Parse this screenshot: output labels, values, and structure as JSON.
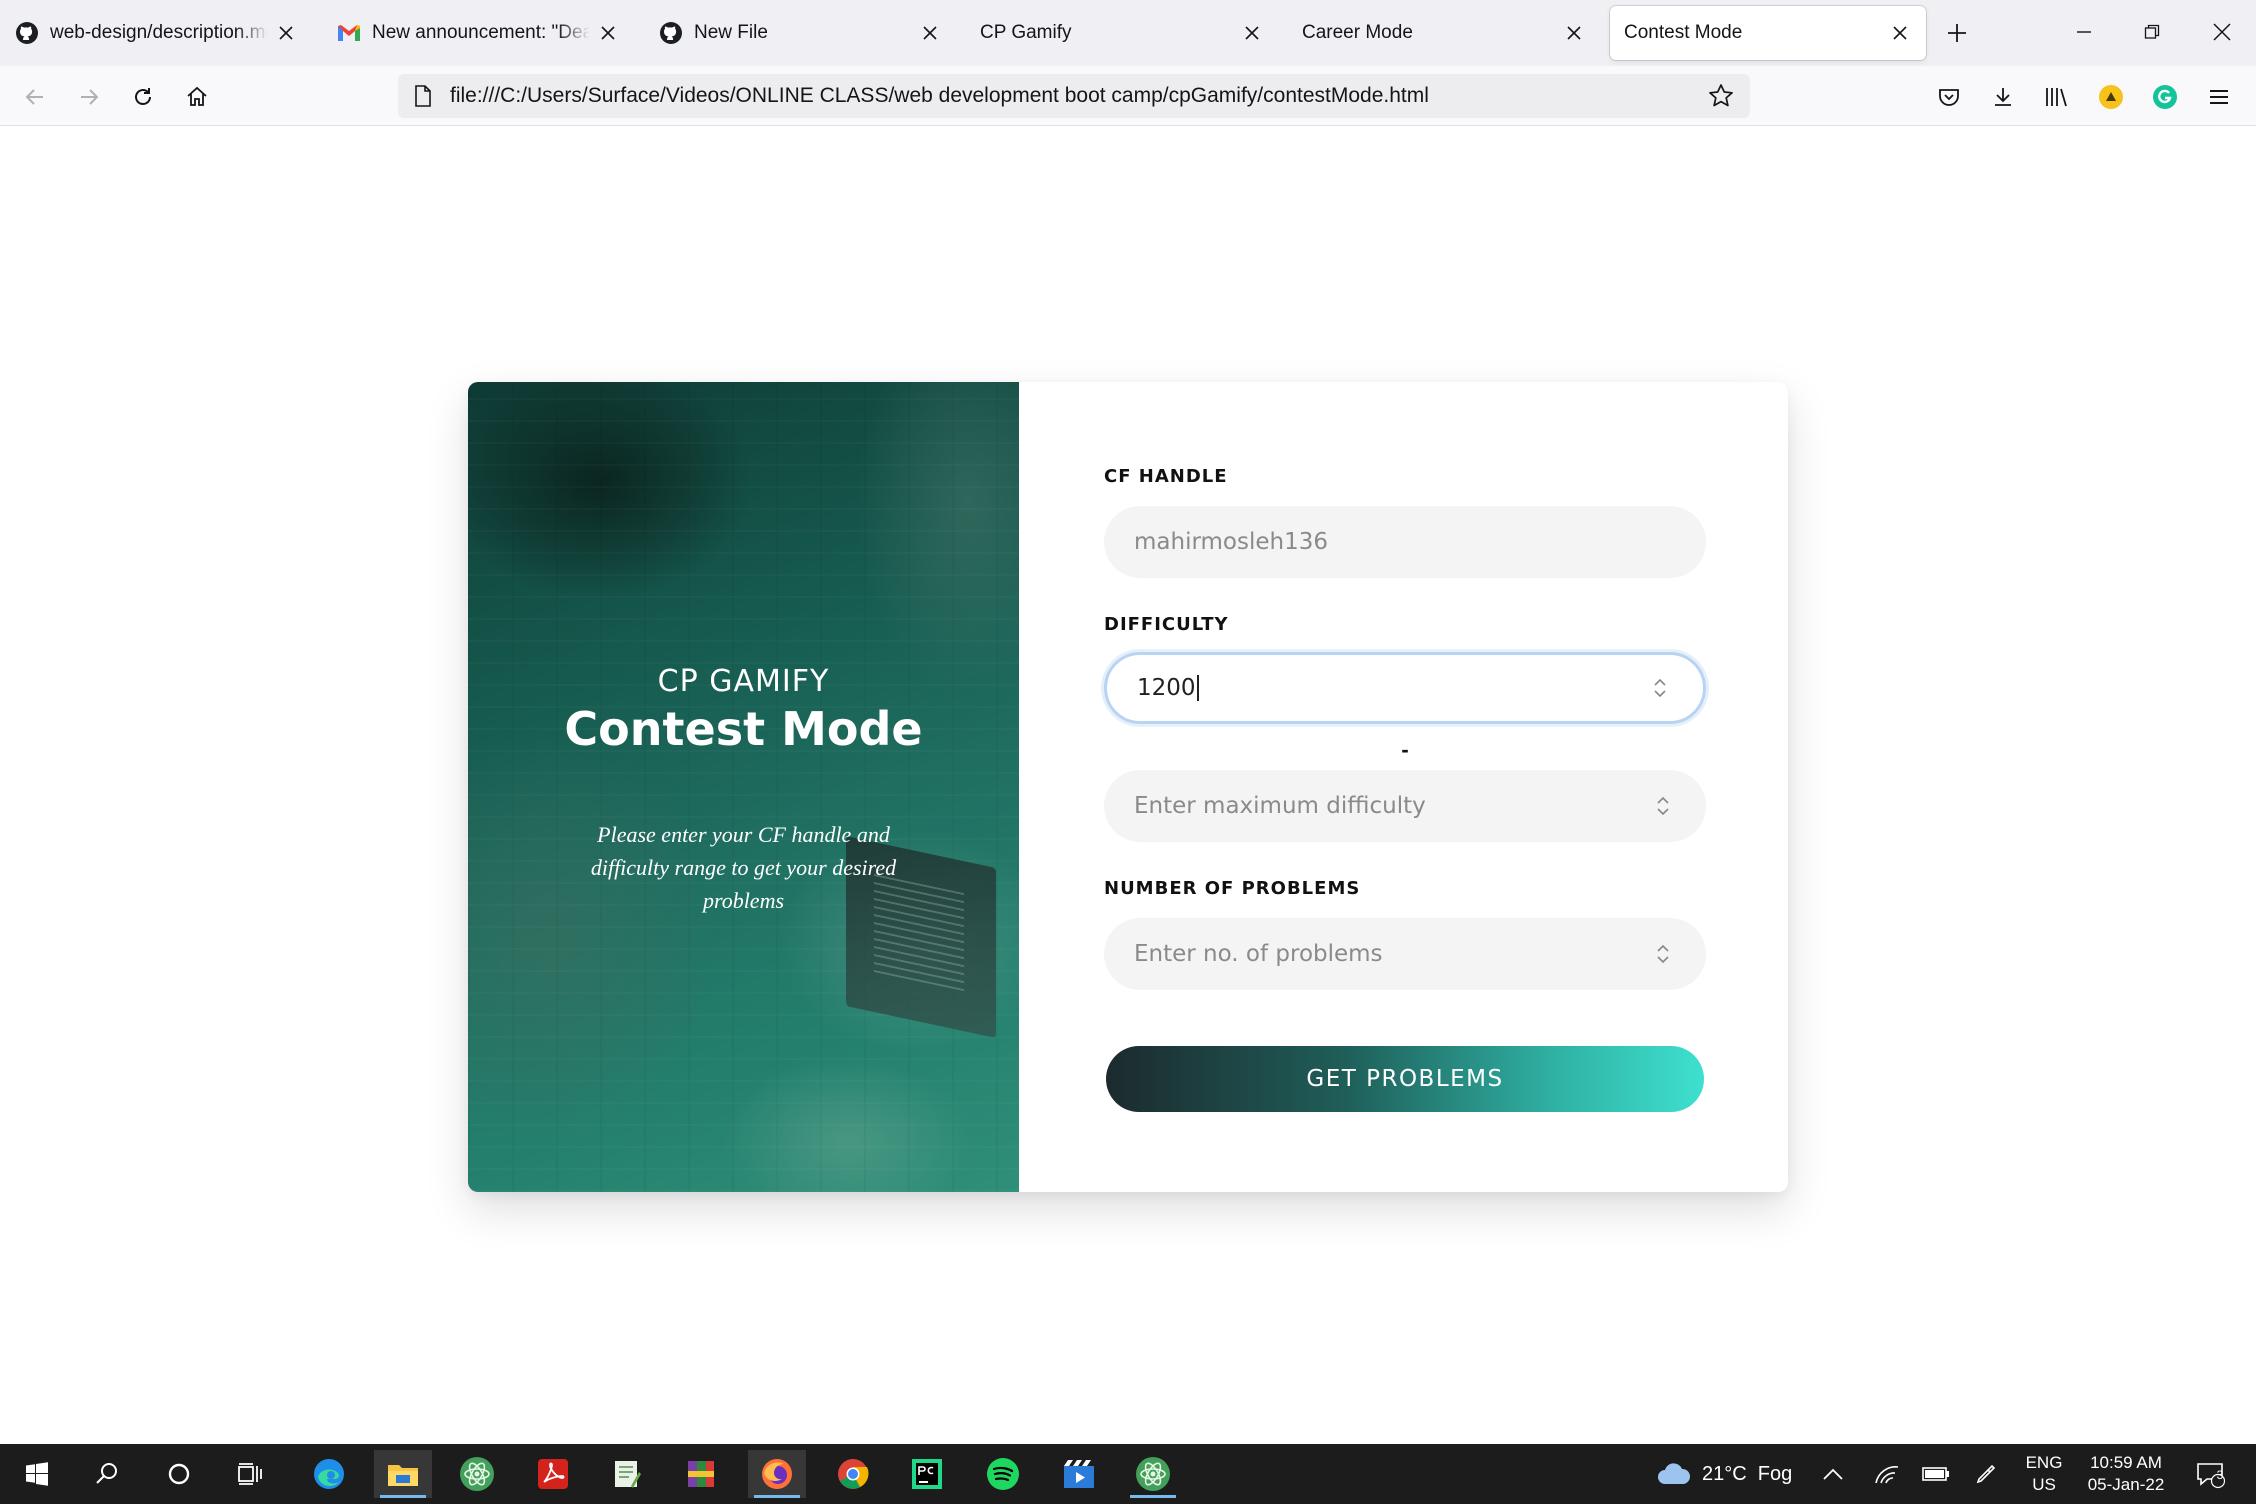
{
  "browser": {
    "tabs": [
      {
        "title": "web-design/description.md at",
        "icon": "github-icon",
        "active": false
      },
      {
        "title": "New announcement: \"Dear Stu",
        "icon": "gmail-icon",
        "active": false
      },
      {
        "title": "New File",
        "icon": "github-icon",
        "active": false
      },
      {
        "title": "CP Gamify",
        "icon": "",
        "active": false
      },
      {
        "title": "Career Mode",
        "icon": "",
        "active": false
      },
      {
        "title": "Contest Mode",
        "icon": "",
        "active": true
      }
    ],
    "url": "file:///C:/Users/Surface/Videos/ONLINE CLASS/web development boot camp/cpGamify/contestMode.html"
  },
  "hero": {
    "subtitle": "CP GAMIFY",
    "title": "Contest Mode",
    "description": "Please enter your CF handle and difficulty range to get your desired problems"
  },
  "form": {
    "handle_label": "CF HANDLE",
    "handle_placeholder": "mahirmosleh136",
    "difficulty_label": "DIFFICULTY",
    "min_difficulty_value": "1200",
    "range_separator": "-",
    "max_difficulty_placeholder": "Enter maximum difficulty",
    "problems_label": "NUMBER OF PROBLEMS",
    "problems_placeholder": "Enter no. of problems",
    "submit_label": "GET PROBLEMS"
  },
  "taskbar": {
    "weather": "21°C  Fog",
    "lang_line1": "ENG",
    "lang_line2": "US",
    "time": "10:59 AM",
    "date": "05-Jan-22",
    "notification_count": "3"
  }
}
